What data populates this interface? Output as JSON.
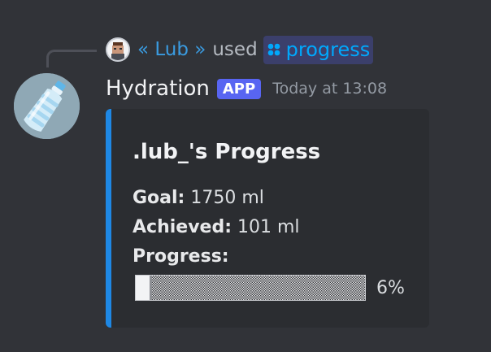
{
  "reply": {
    "user": "« Lub »",
    "used_text": "used",
    "command": "progress",
    "command_icon": "apps-icon"
  },
  "author": {
    "name": "Hydration",
    "badge": "APP",
    "timestamp": "Today at 13:08",
    "avatar_icon": "water-bottle-icon"
  },
  "embed": {
    "accent_color": "#1e88e5",
    "title": ".lub_'s Progress",
    "goal_label": "Goal:",
    "goal_value": "1750 ml",
    "achieved_label": "Achieved:",
    "achieved_value": "101 ml",
    "progress_label": "Progress:",
    "progress_fraction": 0.06,
    "progress_text": "6%"
  },
  "colors": {
    "background": "#313338",
    "embed_background": "#2b2d31",
    "link": "#00a8fc",
    "badge": "#5865f2"
  }
}
